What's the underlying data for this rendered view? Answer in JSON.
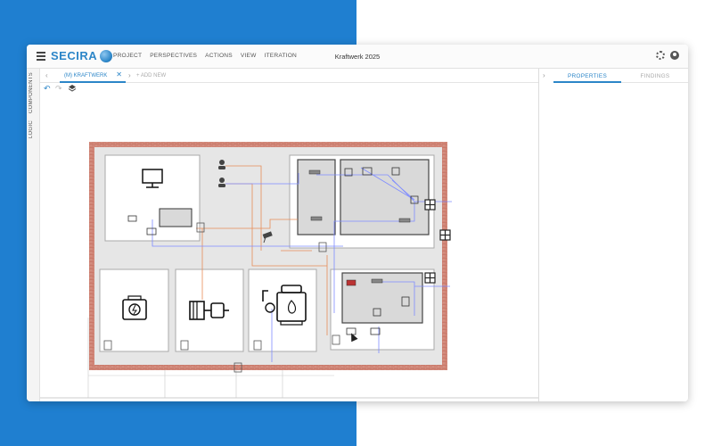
{
  "app": {
    "logo": "SECIRA",
    "window_title": "Kraftwerk 2025",
    "menu": [
      "PROJECT",
      "PERSPECTIVES",
      "ACTIONS",
      "VIEW",
      "ITERATION"
    ]
  },
  "sidebar": {
    "tabs": [
      "COMPONENTS",
      "LOGIC"
    ]
  },
  "editor": {
    "tab_prefix": "(M)",
    "tab_label": "(M) KRAFTWERK",
    "add_new": "+ ADD NEW"
  },
  "right_panel": {
    "tabs": [
      "PROPERTIES",
      "FINDINGS"
    ]
  },
  "colors": {
    "accent": "#2c86c8",
    "background_left": "#1f7fd0",
    "wall": "#c9796a",
    "zone": "#e6e6e6",
    "link_orange": "#e88c58",
    "link_blue": "#7f8cff"
  },
  "icons": {
    "menu": "hamburger-icon",
    "settings": "gear-icon",
    "account": "user-icon",
    "undo": "undo-icon",
    "redo": "redo-icon",
    "layers": "layers-icon",
    "close": "close-icon"
  }
}
